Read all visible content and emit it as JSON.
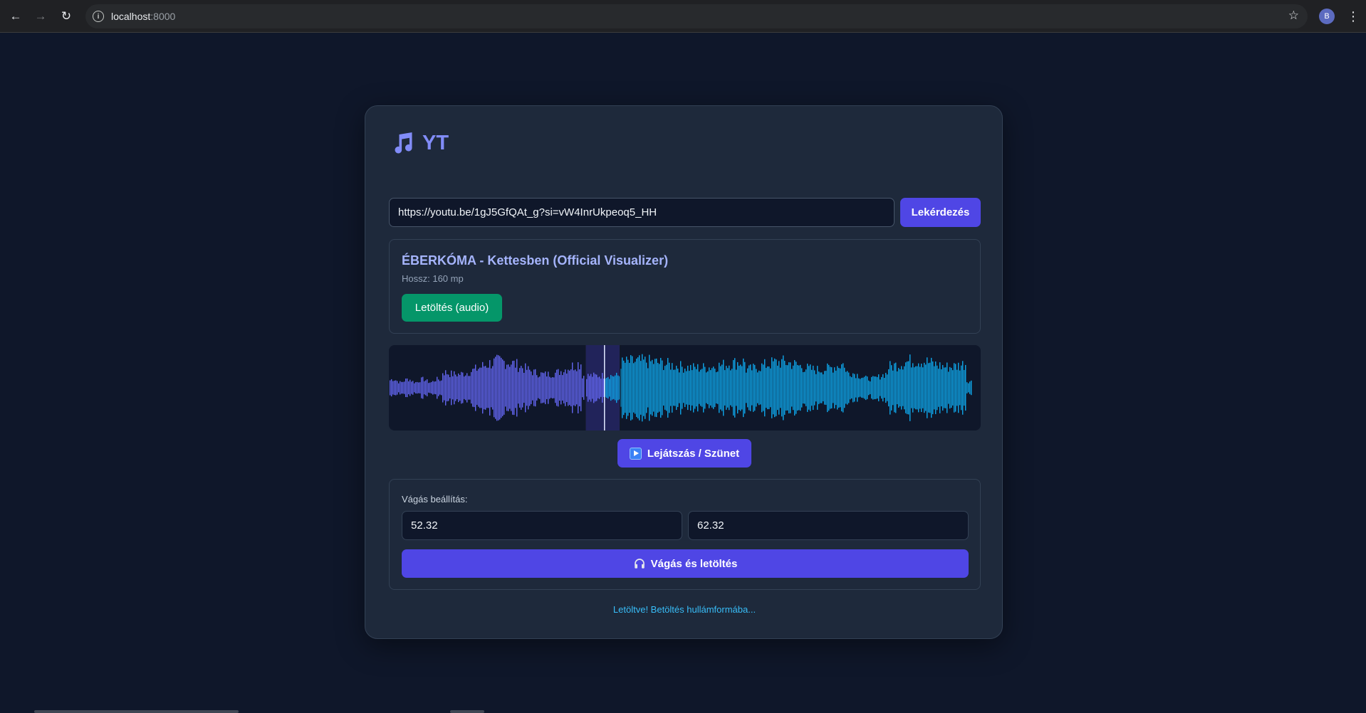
{
  "browser": {
    "url_host": "localhost",
    "url_port": ":8000",
    "profile_initial": "B"
  },
  "app": {
    "title": "YT",
    "brand_icon": "music-note-icon",
    "accent": "#818cf8"
  },
  "search": {
    "url_value": "https://youtu.be/1gJ5GfQAt_g?si=vW4InrUkpeoq5_HH",
    "query_label": "Lekérdezés"
  },
  "video": {
    "title": "ÉBERKÓMA - Kettesben (Official Visualizer)",
    "duration": "Hossz: 160 mp",
    "download_audio_label": "Letöltés (audio)"
  },
  "waveform": {
    "played_color": "#6366f1",
    "unplayed_color": "#0ea5e9",
    "playhead_fraction": 0.363
  },
  "player": {
    "play_pause_label": "Lejátszás / Szünet"
  },
  "cut": {
    "label": "Vágás beállítás:",
    "start": "52.32",
    "end": "62.32",
    "cut_download_label": "Vágás és letöltés"
  },
  "status": {
    "message": "Letöltve! Betöltés hullámformába..."
  }
}
